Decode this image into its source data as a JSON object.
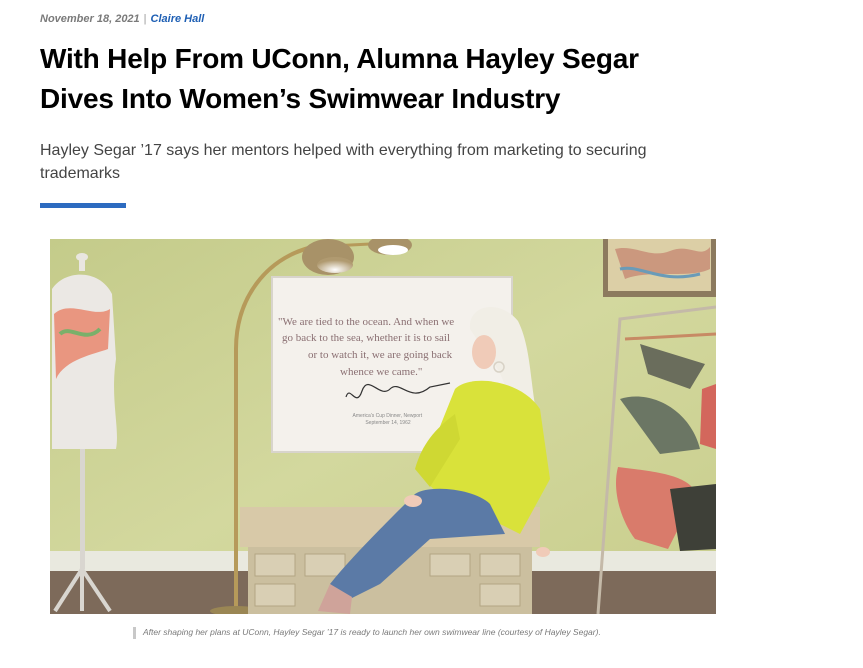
{
  "article": {
    "date": "November 18, 2021",
    "separator": "|",
    "author": "Claire Hall",
    "title": "With Help From UConn, Alumna Hayley Segar Dives Into Women’s Swimwear Industry",
    "subtitle": "Hayley Segar ’17 says her mentors helped with everything from marketing to securing trademarks"
  },
  "photo": {
    "quote_lines": [
      "\"We are tied to the ocean. And when we",
      "go back to the sea, whether it is to sail",
      "or to watch it, we are going back",
      "whence we came.\""
    ],
    "quote_attribution_lines": [
      "America's Cup Dinner, Newport",
      "September 14, 1962"
    ],
    "caption": "After shaping her plans at UConn, Hayley Segar ’17 is ready to launch her own swimwear line (courtesy of Hayley Segar)."
  },
  "colors": {
    "accent_rule": "#2d6bc0",
    "author_link": "#1e5fb4",
    "wall": "#cfd49a",
    "shirt": "#d9e23a",
    "jeans": "#5b7aa6",
    "hair": "#f1eee6"
  }
}
